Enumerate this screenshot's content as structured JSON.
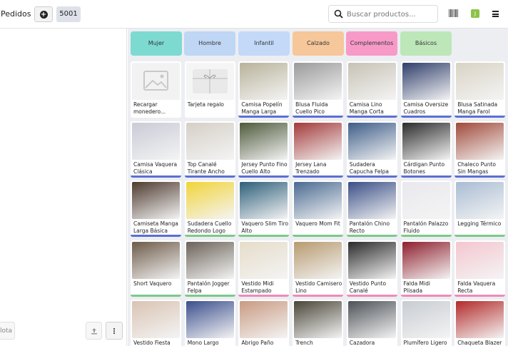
{
  "header": {
    "orders_label": "Pedidos",
    "order_number": "5001",
    "search_placeholder": "Buscar productos...",
    "user_initial": "J"
  },
  "footer": {
    "note_label": "lota"
  },
  "categories": [
    {
      "label": "Mujer",
      "color": "#7ddad1"
    },
    {
      "label": "Hombre",
      "color": "#bfd6f5"
    },
    {
      "label": "Infantil",
      "color": "#c3d9f7"
    },
    {
      "label": "Calzado",
      "color": "#f6c79a"
    },
    {
      "label": "Complementos",
      "color": "#f79ac8"
    },
    {
      "label": "Básicos",
      "color": "#bde7b9"
    }
  ],
  "products": [
    {
      "name": "Recargar monedero...",
      "bar": "",
      "img": "placeholder"
    },
    {
      "name": "Tarjeta regalo",
      "bar": "",
      "img": "giftcard"
    },
    {
      "name": "Camisa Popelín Manga Larga",
      "bar": "#5a6fd4",
      "img": "#b8b29a"
    },
    {
      "name": "Blusa Fluida Cuello Pico",
      "bar": "#5a6fd4",
      "img": "#9a9a9a"
    },
    {
      "name": "Camisa Lino Manga Corta",
      "bar": "#5a6fd4",
      "img": "#c7c2b5"
    },
    {
      "name": "Camisa Oversize Cuadros",
      "bar": "#5a6fd4",
      "img": "#2f3e6b"
    },
    {
      "name": "Blusa Satinada Manga Farol",
      "bar": "#5a6fd4",
      "img": "#d9d3c4"
    },
    {
      "name": "Camisa Vaquera Clásica",
      "bar": "#5a6fd4",
      "img": "#c9cbd6"
    },
    {
      "name": "Top Canalé Tirante Ancho",
      "bar": "#5a6fd4",
      "img": "#d5cfc6"
    },
    {
      "name": "Jersey Punto Fino Cuello Alto",
      "bar": "#5a6fd4",
      "img": "#4e5a3c"
    },
    {
      "name": "Jersey Lana Trenzado",
      "bar": "#5a6fd4",
      "img": "#a33a3a"
    },
    {
      "name": "Sudadera Capucha Felpa",
      "bar": "#5a6fd4",
      "img": "#3e5d88"
    },
    {
      "name": "Cárdigan Punto Botones",
      "bar": "#5a6fd4",
      "img": "#2b2b2b"
    },
    {
      "name": "Chaleco Punto Sin Mangas",
      "bar": "#5a6fd4",
      "img": "#a04a3a"
    },
    {
      "name": "Camiseta Manga Larga Básica",
      "bar": "#5a6fd4",
      "img": "#4d3a2e"
    },
    {
      "name": "Sudadera Cuello Redondo Logo",
      "bar": "#7cc98a",
      "img": "#f1d43a"
    },
    {
      "name": "Vaquero Slim Tiro Alto",
      "bar": "#7cc98a",
      "img": "#2d5f7a"
    },
    {
      "name": "Vaquero Mom Fit",
      "bar": "#7cc98a",
      "img": "#4a6a91"
    },
    {
      "name": "Pantalón Chino Recto",
      "bar": "#7cc98a",
      "img": "#3a4f86"
    },
    {
      "name": "Pantalón Palazzo Fluido",
      "bar": "#7cc98a",
      "img": "#e9e9ee"
    },
    {
      "name": "Legging Térmico",
      "bar": "#7cc98a",
      "img": "#a9bcd3"
    },
    {
      "name": "Short Vaquero",
      "bar": "#7cc98a",
      "img": "#6d5a48"
    },
    {
      "name": "Pantalón Jogger Felpa",
      "bar": "#7cc98a",
      "img": "#6b6258"
    },
    {
      "name": "Vestido Midi Estampado",
      "bar": "#f08ab8",
      "img": "#e6dcc9"
    },
    {
      "name": "Vestido Camisero Lino",
      "bar": "#f08ab8",
      "img": "#b79a6f"
    },
    {
      "name": "Vestido Punto Canalé",
      "bar": "#f08ab8",
      "img": "#2a2a2a"
    },
    {
      "name": "Falda Midi Plisada",
      "bar": "#f08ab8",
      "img": "#8e1f2d"
    },
    {
      "name": "Falda Vaquera Recta",
      "bar": "#f08ab8",
      "img": "#f4c6cf"
    },
    {
      "name": "Vestido Fiesta",
      "bar": "",
      "img": "#d9c3b3"
    },
    {
      "name": "Mono Largo",
      "bar": "",
      "img": "#3b4f8c"
    },
    {
      "name": "Abrigo Paño",
      "bar": "",
      "img": "#c99a82"
    },
    {
      "name": "Trench",
      "bar": "",
      "img": "#4a4538"
    },
    {
      "name": "Cazadora",
      "bar": "",
      "img": "#4d5257"
    },
    {
      "name": "Plumífero Ligero",
      "bar": "",
      "img": "#c8ccd2"
    },
    {
      "name": "Chaqueta Blazer",
      "bar": "",
      "img": "#b32a2a"
    }
  ]
}
